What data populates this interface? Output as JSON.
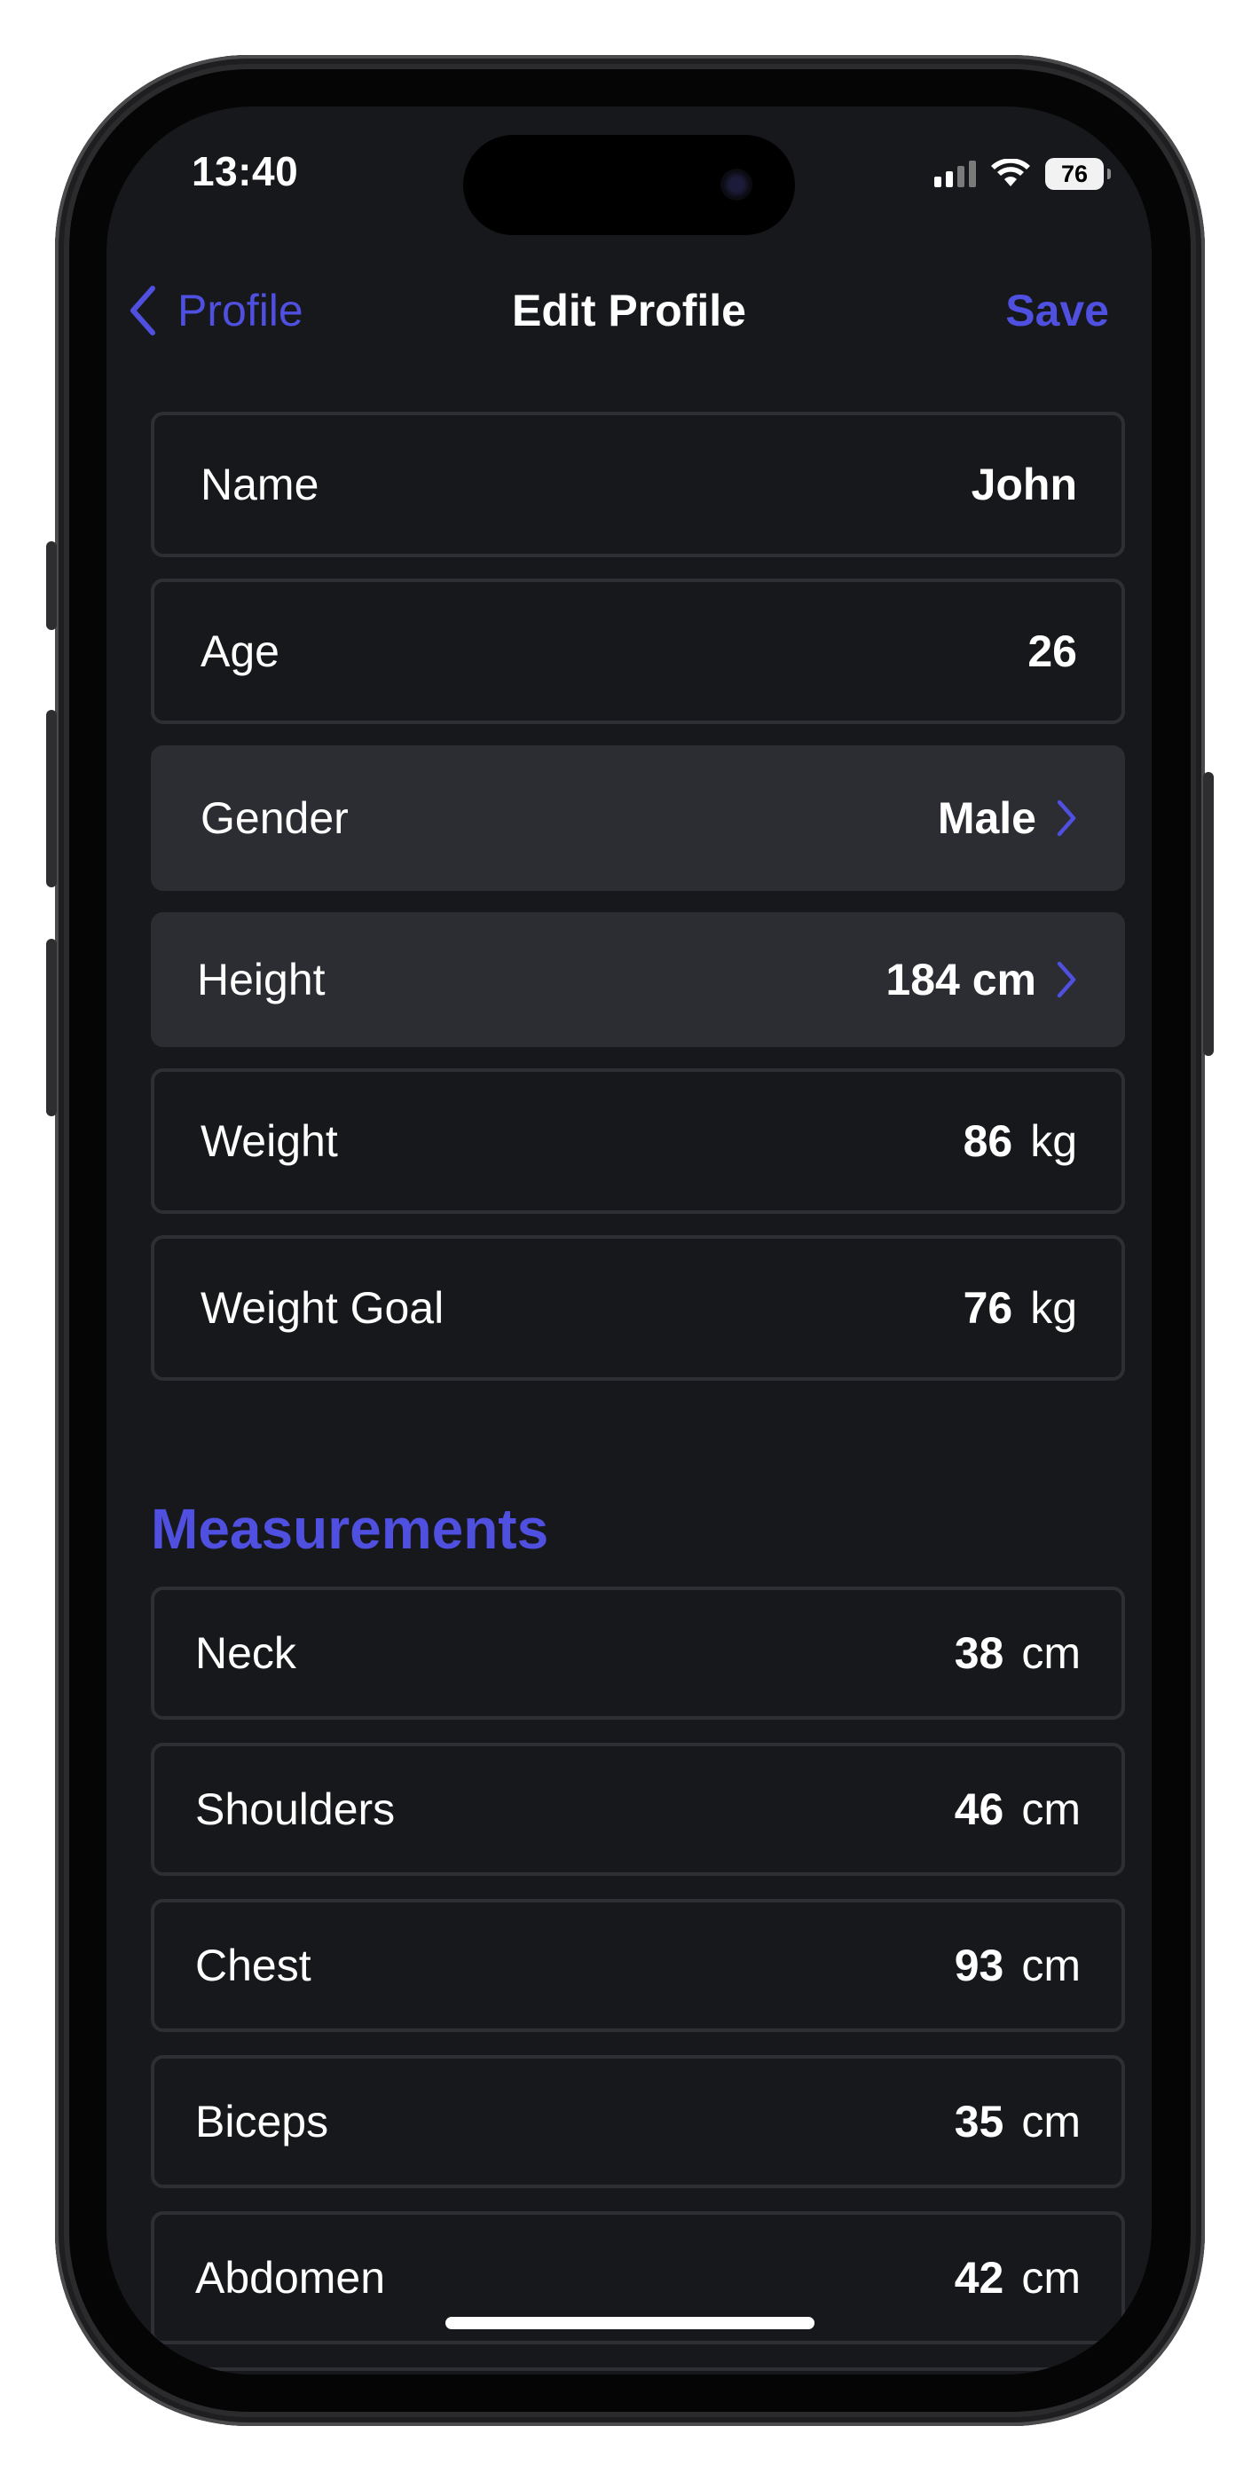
{
  "status_bar": {
    "time": "13:40",
    "battery": "76"
  },
  "nav": {
    "back_label": "Profile",
    "title": "Edit Profile",
    "save_label": "Save"
  },
  "profile_fields": [
    {
      "label": "Name",
      "value": "John"
    },
    {
      "label": "Age",
      "value": "26"
    },
    {
      "label": "Gender",
      "value": "Male"
    },
    {
      "label": "Height",
      "value": "184 cm"
    },
    {
      "label": "Weight",
      "value": "86",
      "unit": "kg"
    },
    {
      "label": "Weight Goal",
      "value": "76",
      "unit": "kg"
    }
  ],
  "measurements": {
    "title": "Measurements",
    "items": [
      {
        "label": "Neck",
        "value": "38",
        "unit": "cm"
      },
      {
        "label": "Shoulders",
        "value": "46",
        "unit": "cm"
      },
      {
        "label": "Chest",
        "value": "93",
        "unit": "cm"
      },
      {
        "label": "Biceps",
        "value": "35",
        "unit": "cm"
      },
      {
        "label": "Abdomen",
        "value": "42",
        "unit": "cm"
      }
    ]
  },
  "colors": {
    "accent": "#4f4fe0",
    "background": "#17181b",
    "row_border": "#2e2f34",
    "picker_row": "#2c2d32"
  }
}
